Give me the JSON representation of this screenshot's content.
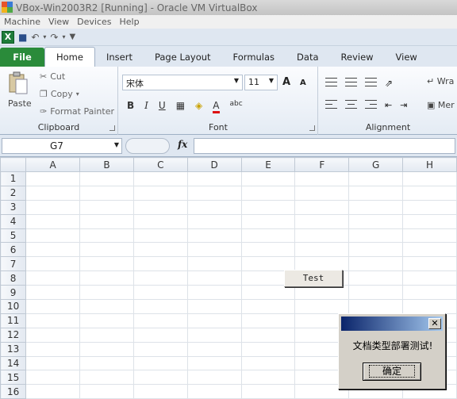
{
  "window": {
    "title": "VBox-Win2003R2 [Running] - Oracle VM VirtualBox"
  },
  "vbox_menu": [
    "Machine",
    "View",
    "Devices",
    "Help"
  ],
  "ribbon_tabs": [
    "File",
    "Home",
    "Insert",
    "Page Layout",
    "Formulas",
    "Data",
    "Review",
    "View"
  ],
  "clipboard": {
    "paste": "Paste",
    "cut": "Cut",
    "copy": "Copy",
    "format_painter": "Format Painter",
    "label": "Clipboard"
  },
  "font": {
    "name": "宋体",
    "size": "11",
    "label": "Font",
    "bold": "B",
    "italic": "I",
    "underline": "U",
    "grow": "A",
    "shrink": "A",
    "color_a": "A",
    "abc": "abc"
  },
  "alignment": {
    "label": "Alignment",
    "wrap": "Wra",
    "merge": "Mer"
  },
  "formula_bar": {
    "cell": "G7",
    "fx": "fx"
  },
  "columns": [
    "A",
    "B",
    "C",
    "D",
    "E",
    "F",
    "G",
    "H"
  ],
  "rows": [
    "1",
    "2",
    "3",
    "4",
    "5",
    "6",
    "7",
    "8",
    "9",
    "10",
    "11",
    "12",
    "13",
    "14",
    "15",
    "16"
  ],
  "sheet_button": {
    "label": "Test"
  },
  "dialog": {
    "message": "文档类型部署测试!",
    "ok": "确定",
    "close": "✕"
  }
}
